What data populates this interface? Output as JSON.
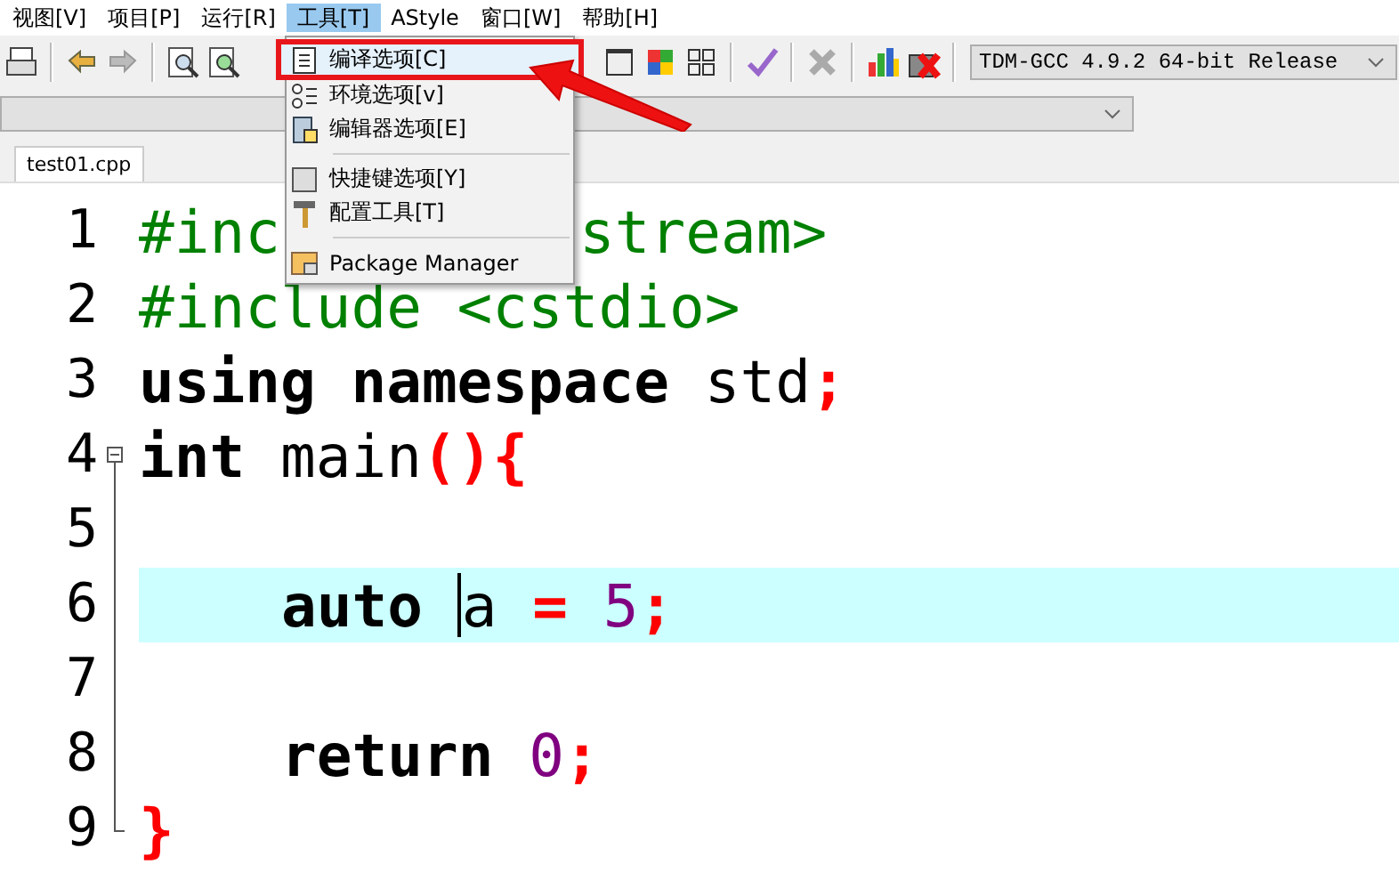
{
  "menu_bar": [
    {
      "label": "视图[V]",
      "selected": false
    },
    {
      "label": "项目[P]",
      "selected": false
    },
    {
      "label": "运行[R]",
      "selected": false
    },
    {
      "label": "工具[T]",
      "selected": true
    },
    {
      "label": "AStyle",
      "selected": false
    },
    {
      "label": "窗口[W]",
      "selected": false
    },
    {
      "label": "帮助[H]",
      "selected": false
    }
  ],
  "toolbar": {
    "compiler": "TDM-GCC 4.9.2 64-bit Release"
  },
  "tabs": [
    {
      "label": "test01.cpp",
      "selected": true
    }
  ],
  "editor": {
    "lines": [
      {
        "number": "1",
        "kind": "plain",
        "tokens": [
          {
            "kind": "preproc",
            "text": "#inc",
            "covered_after": true
          },
          {
            "kind": "preproc",
            "text": "stream>"
          }
        ]
      },
      {
        "number": "2",
        "kind": "plain",
        "tokens": [
          {
            "kind": "preproc",
            "text": "#include <cstdio>"
          }
        ]
      },
      {
        "number": "3",
        "kind": "plain",
        "tokens": [
          {
            "kind": "keyword",
            "text": "using namespace "
          },
          {
            "kind": "plain",
            "text": "std"
          },
          {
            "kind": "symbol",
            "text": ";"
          }
        ]
      },
      {
        "number": "4",
        "kind": "plain",
        "fold_start": true,
        "tokens": [
          {
            "kind": "keyword",
            "text": "int "
          },
          {
            "kind": "plain",
            "text": "main"
          },
          {
            "kind": "symbol",
            "text": "(){"
          }
        ]
      },
      {
        "number": "5",
        "kind": "blank"
      },
      {
        "number": "6",
        "kind": "indented",
        "current": true,
        "tokens": [
          {
            "kind": "keyword",
            "text": "auto ",
            "cursor_after": true
          },
          {
            "kind": "plain",
            "text": "a "
          },
          {
            "kind": "symbol",
            "text": "= "
          },
          {
            "kind": "number",
            "text": "5"
          },
          {
            "kind": "symbol",
            "text": ";"
          }
        ]
      },
      {
        "number": "7",
        "kind": "blank"
      },
      {
        "number": "8",
        "kind": "indented",
        "tokens": [
          {
            "kind": "keyword",
            "text": "return "
          },
          {
            "kind": "number",
            "text": "0"
          },
          {
            "kind": "symbol",
            "text": ";"
          }
        ]
      },
      {
        "number": "9",
        "kind": "plain",
        "fold_end": true,
        "tokens": [
          {
            "kind": "symbol",
            "text": "}"
          }
        ]
      }
    ]
  },
  "dropdown_menu": {
    "items": [
      {
        "kind": "item",
        "label": "编译选项[C]",
        "selected": true
      },
      {
        "kind": "item",
        "label": "环境选项[v]",
        "selected": false
      },
      {
        "kind": "item",
        "label": "编辑器选项[E]",
        "selected": false
      },
      {
        "kind": "separator"
      },
      {
        "kind": "item",
        "label": "快捷键选项[Y]",
        "selected": false
      },
      {
        "kind": "item",
        "label": "配置工具[T]",
        "selected": false
      },
      {
        "kind": "separator"
      },
      {
        "kind": "item",
        "label": "Package Manager",
        "selected": false
      }
    ]
  }
}
